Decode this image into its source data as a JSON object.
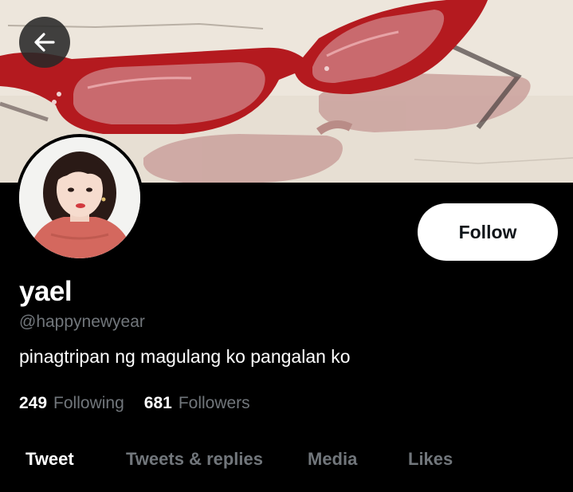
{
  "header": {
    "back_icon": "arrow-left-icon"
  },
  "banner": {
    "description_icon": "red-sunglasses-photo"
  },
  "avatar": {
    "icon": "profile-photo"
  },
  "profile": {
    "display_name": "yael",
    "handle": "@happynewyear",
    "bio": "pinagtripan ng magulang ko pangalan ko"
  },
  "actions": {
    "follow_label": "Follow"
  },
  "stats": {
    "following_count": "249",
    "following_label": "Following",
    "followers_count": "681",
    "followers_label": "Followers"
  },
  "tabs": [
    {
      "label": "Tweet",
      "active": true
    },
    {
      "label": "Tweets & replies",
      "active": false
    },
    {
      "label": "Media",
      "active": false
    },
    {
      "label": "Likes",
      "active": false
    }
  ],
  "colors": {
    "background": "#000000",
    "primary_text": "#ffffff",
    "secondary_text": "#71767b",
    "follow_button_bg": "#ffffff",
    "follow_button_text": "#0f1419"
  }
}
